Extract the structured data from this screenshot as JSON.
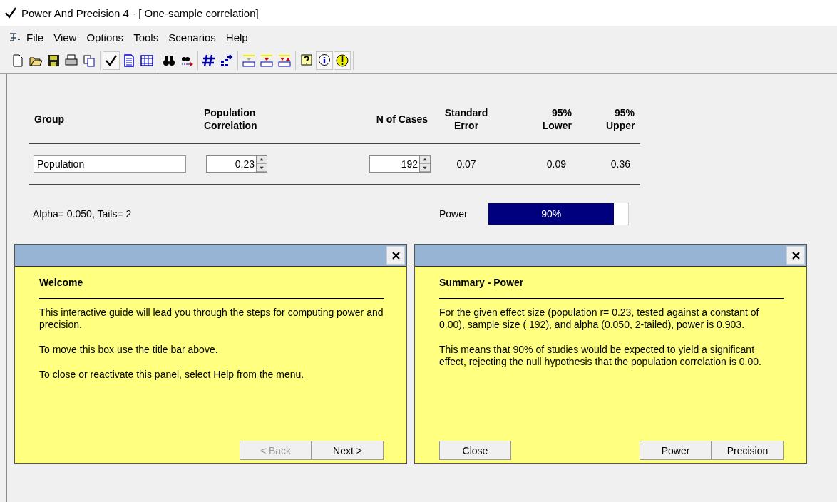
{
  "window": {
    "title": "Power And Precision 4 - [ One-sample correlation]"
  },
  "menu": [
    "File",
    "View",
    "Options",
    "Tools",
    "Scenarios",
    "Help"
  ],
  "toolbar": [
    [
      {
        "kind": "new",
        "pressed": false
      },
      {
        "kind": "open",
        "pressed": false
      },
      {
        "kind": "save",
        "pressed": false
      },
      {
        "kind": "print",
        "pressed": false
      },
      {
        "kind": "copy",
        "pressed": false
      }
    ],
    [
      {
        "kind": "check",
        "pressed": true
      },
      {
        "kind": "document",
        "pressed": false
      },
      {
        "kind": "table",
        "pressed": false
      }
    ],
    [
      {
        "kind": "find",
        "pressed": false
      },
      {
        "kind": "find-next",
        "pressed": false
      }
    ],
    [
      {
        "kind": "hash",
        "pressed": false
      },
      {
        "kind": "arrange",
        "pressed": false
      }
    ],
    [
      {
        "kind": "rule",
        "pressed": false
      },
      {
        "kind": "rule-down",
        "pressed": false
      },
      {
        "kind": "rule-up",
        "pressed": false
      }
    ],
    [
      {
        "kind": "help",
        "pressed": false
      },
      {
        "kind": "info",
        "pressed": true
      },
      {
        "kind": "warning",
        "pressed": true
      }
    ]
  ],
  "table": {
    "columns": [
      "Group",
      "Population Correlation",
      "N of Cases",
      "Standard Error",
      "95% Lower",
      "95% Upper"
    ],
    "row": [
      {
        "kind": "text-input",
        "value": "Population"
      },
      {
        "kind": "spinner",
        "value": "0.23"
      },
      {
        "kind": "spinner",
        "value": "192"
      },
      {
        "kind": "value",
        "value": "0.07"
      },
      {
        "kind": "value",
        "value": "0.09"
      },
      {
        "kind": "value",
        "value": "0.36"
      }
    ]
  },
  "alpha_note": "Alpha= 0.050, Tails= 2",
  "power": {
    "label": "Power",
    "level": 0.9,
    "reading": "90%"
  },
  "panels": [
    {
      "title": "Welcome",
      "paragraphs": [
        "This interactive guide will lead you through the steps for computing power and precision.",
        "To move this box use the title bar above.",
        "To close or reactivate this panel, select Help from the menu."
      ],
      "buttons_right": [
        {
          "label": "< Back",
          "disabled": true
        },
        {
          "label": "Next >",
          "disabled": false
        }
      ]
    },
    {
      "title": "Summary - Power",
      "paragraphs": [
        "For the given effect size (population r=  0.23,  tested against a constant of  0.00),  sample size ( 192), and alpha (0.050, 2-tailed), power is 0.903.",
        "This means that 90% of studies would be expected to yield a significant effect, rejecting the null hypothesis that the population correlation is 0.00."
      ],
      "buttons_left": [
        {
          "label": "Close",
          "disabled": false
        }
      ],
      "buttons_right": [
        {
          "label": "Power",
          "disabled": false
        },
        {
          "label": "Precision",
          "disabled": false
        }
      ]
    }
  ]
}
